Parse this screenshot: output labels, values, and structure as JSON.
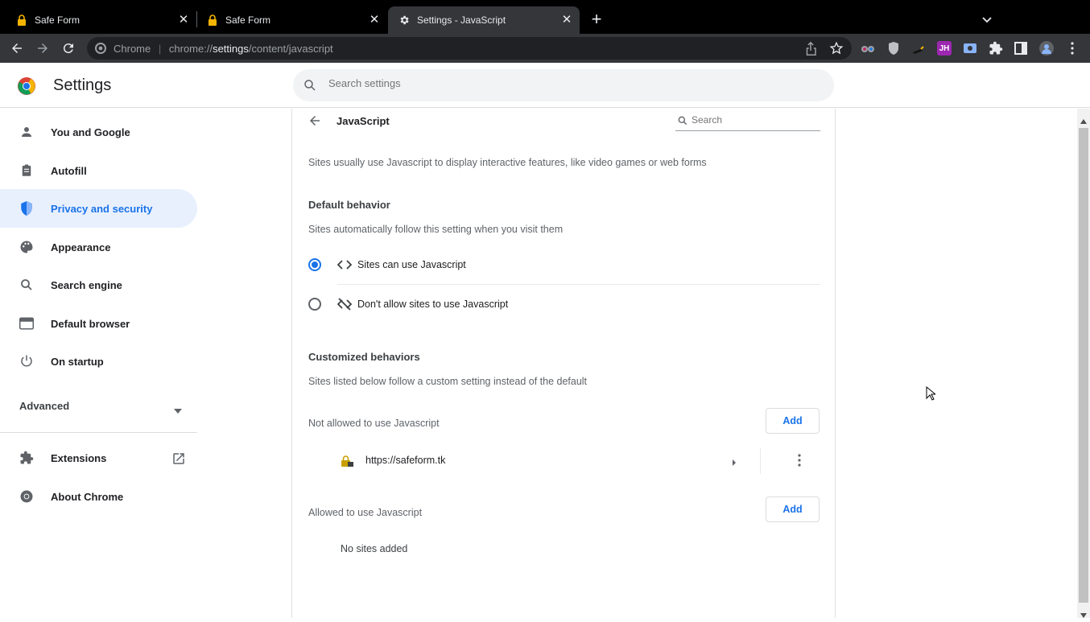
{
  "tabs": [
    {
      "title": "Safe Form",
      "icon": "lock-icon"
    },
    {
      "title": "Safe Form",
      "icon": "lock-icon"
    },
    {
      "title": "Settings - JavaScript",
      "icon": "gear-icon",
      "active": true
    }
  ],
  "toolbar": {
    "site_chip": "Chrome",
    "url_prefix": "chrome://",
    "url_host": "settings",
    "url_path": "/content/javascript",
    "extension_label_jh": "JH"
  },
  "header": {
    "title": "Settings",
    "search_placeholder": "Search settings"
  },
  "sidebar": {
    "items": [
      {
        "label": "You and Google",
        "icon": "person-icon"
      },
      {
        "label": "Autofill",
        "icon": "clipboard-icon"
      },
      {
        "label": "Privacy and security",
        "icon": "shield-icon",
        "selected": true
      },
      {
        "label": "Appearance",
        "icon": "palette-icon"
      },
      {
        "label": "Search engine",
        "icon": "search-icon"
      },
      {
        "label": "Default browser",
        "icon": "browser-icon"
      },
      {
        "label": "On startup",
        "icon": "power-icon"
      }
    ],
    "advanced": "Advanced",
    "extensions": "Extensions",
    "about": "About Chrome"
  },
  "main": {
    "page_title": "JavaScript",
    "search_placeholder": "Search",
    "description": "Sites usually use Javascript to display interactive features, like video games or web forms",
    "default_behavior": {
      "title": "Default behavior",
      "subtitle": "Sites automatically follow this setting when you visit them",
      "options": [
        {
          "label": "Sites can use Javascript",
          "selected": true
        },
        {
          "label": "Don't allow sites to use Javascript",
          "selected": false
        }
      ]
    },
    "customized": {
      "title": "Customized behaviors",
      "subtitle": "Sites listed below follow a custom setting instead of the default",
      "not_allowed_label": "Not allowed to use Javascript",
      "not_allowed_sites": [
        "https://safeform.tk"
      ],
      "allowed_label": "Allowed to use Javascript",
      "allowed_empty": "No sites added",
      "add_label": "Add"
    }
  },
  "colors": {
    "accent": "#1a73e8",
    "tabstrip": "#000000",
    "toolbar": "#35363a",
    "selected_nav_bg": "#e8f0fe"
  }
}
